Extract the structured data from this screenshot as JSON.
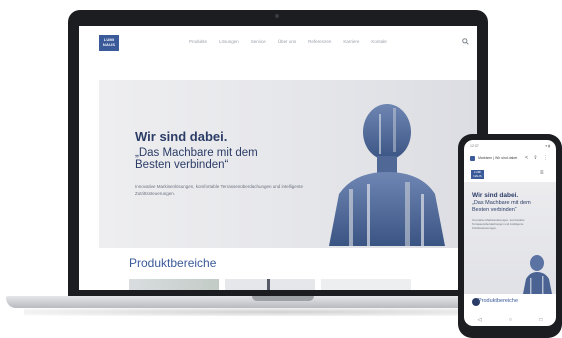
{
  "website": {
    "logo_text": "LUMI\nNAUS",
    "nav_items": [
      "Produkte",
      "Lösungen",
      "Service",
      "Über uns",
      "Referenzen",
      "Karriere",
      "Kontakt"
    ],
    "hero": {
      "title": "Wir sind dabei.",
      "subtitle": "„Das Machbare mit dem Besten verbinden“",
      "body": "Innovative Markisenlösungen, komfortable Terrassenüberdachungen und intelligente Zutrittssteuerungen.",
      "slides_total": 5,
      "active_slide": 1
    },
    "section_title": "Produktbereiche"
  },
  "phone": {
    "status_time": "12:37",
    "status_icons": "▾ ▮",
    "url_text": "Markisen | Wir sind dabei",
    "url_icons": "< ⇪ ⋮",
    "menu_icon": "≡",
    "hero": {
      "title": "Wir sind dabei.",
      "subtitle": "„Das Machbare mit dem Besten verbinden“",
      "body": "Innovative Markisenlösungen, komfortable Terrassenüberdachungen und intelligente Zutrittssteuerungen."
    },
    "section_title": "Produktbereiche",
    "navbar": [
      "◁",
      "○",
      "□"
    ]
  },
  "colors": {
    "brand": "#3a5a9a",
    "heading": "#2b3c66",
    "device": "#1c1d20"
  },
  "icons": {
    "search": "search-icon",
    "menu": "hamburger-menu-icon"
  }
}
